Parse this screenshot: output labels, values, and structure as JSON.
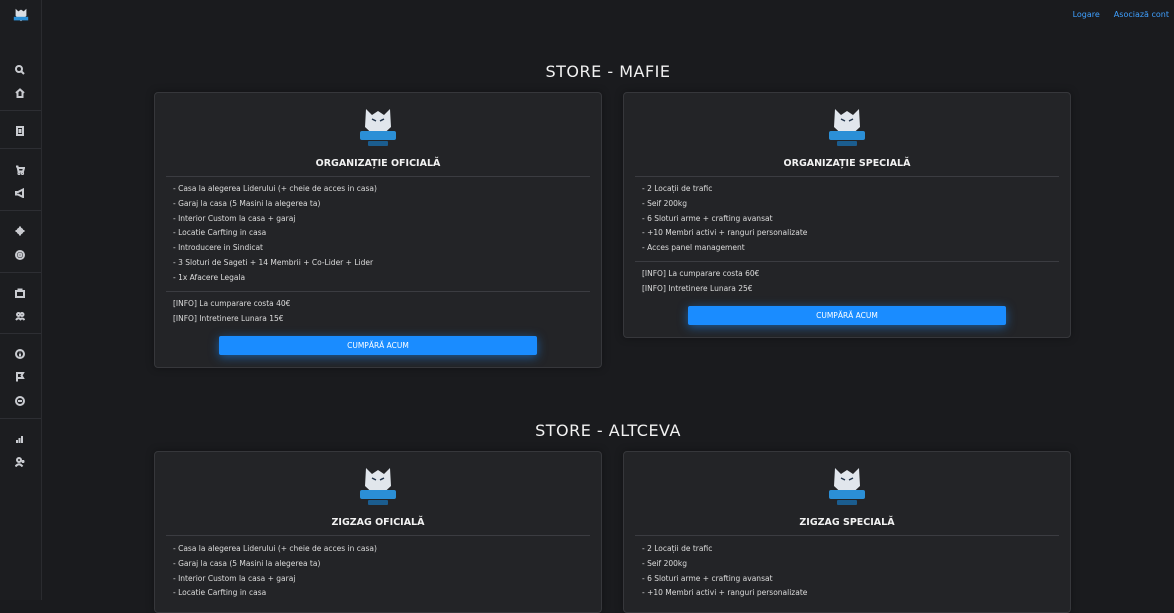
{
  "nav": {
    "login": "Logare",
    "link_account": "Asociază cont"
  },
  "sidebar": {
    "icons": [
      "search-icon",
      "home-icon",
      "document-icon",
      "cart-icon",
      "megaphone-icon",
      "crosshair-icon",
      "target-icon",
      "box-icon",
      "users-icon",
      "info-icon",
      "flag-icon",
      "chat-icon",
      "chart-icon",
      "user-add-icon"
    ]
  },
  "sections": [
    {
      "title": "STORE - MAFIE",
      "cards": [
        {
          "title": "ORGANIZAȚIE OFICIALĂ",
          "features": [
            "- Casa la alegerea Liderului (+ cheie de acces in casa)",
            "- Garaj la casa (5 Masini la alegerea ta)",
            "- Interior Custom la casa + garaj",
            "- Locatie Carfting in casa",
            "- Introducere in Sindicat",
            "- 3 Sloturi de Sageti + 14 Membrii + Co-Lider + Lider",
            "- 1x Afacere Legala"
          ],
          "info": [
            "[INFO] La cumparare costa 40€",
            "[INFO] Intretinere Lunara 15€"
          ],
          "button": "CUMPĂRĂ ACUM"
        },
        {
          "title": "ORGANIZAȚIE SPECIALĂ",
          "features": [
            "- 2 Locații de trafic",
            "- Seif 200kg",
            "- 6 Sloturi arme + crafting avansat",
            "- +10 Membri activi + ranguri personalizate",
            "- Acces panel management"
          ],
          "info": [
            "[INFO] La cumparare costa 60€",
            "[INFO] Intretinere Lunara 25€"
          ],
          "button": "CUMPĂRĂ ACUM"
        }
      ]
    },
    {
      "title": "STORE - ALTCEVA",
      "cards": [
        {
          "title": "ZIGZAG OFICIALĂ",
          "features": [
            "- Casa la alegerea Liderului (+ cheie de acces in casa)",
            "- Garaj la casa (5 Masini la alegerea ta)",
            "- Interior Custom la casa + garaj",
            "- Locatie Carfting in casa"
          ]
        },
        {
          "title": "ZIGZAG SPECIALĂ",
          "features": [
            "- 2 Locații de trafic",
            "- Seif 200kg",
            "- 6 Sloturi arme + crafting avansat",
            "- +10 Membri activi + ranguri personalizate"
          ]
        }
      ]
    }
  ],
  "colors": {
    "accent": "#1a8cff",
    "link": "#3fa0ff",
    "background": "#1a1b1e",
    "card": "#232427"
  }
}
